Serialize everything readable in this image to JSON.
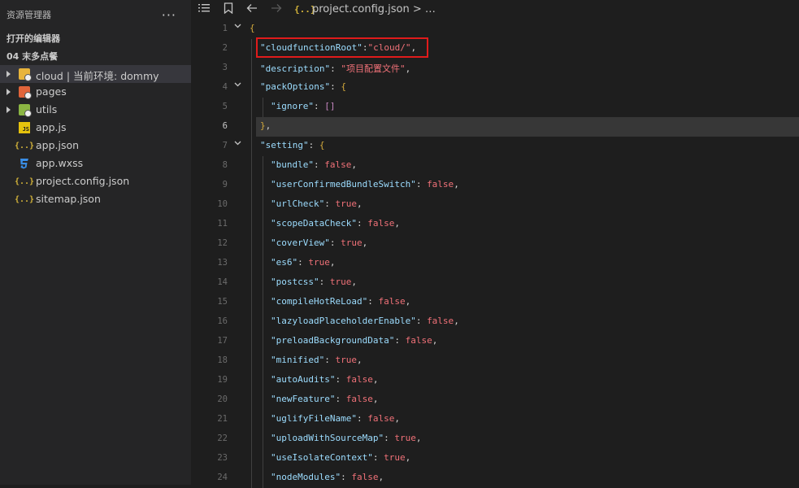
{
  "sidebar": {
    "title": "资源管理器",
    "more": "···",
    "open_editors": "打开的编辑器",
    "project": "04 末多点餐",
    "tree": [
      {
        "label": "cloud | 当前环境: dommy",
        "icon": "cloud-folder-icon",
        "folder": true
      },
      {
        "label": "pages",
        "icon": "pages-folder-icon",
        "folder": true
      },
      {
        "label": "utils",
        "icon": "utils-folder-icon",
        "folder": true
      },
      {
        "label": "app.js",
        "icon": "js-file-icon",
        "folder": false
      },
      {
        "label": "app.json",
        "icon": "json-file-icon",
        "folder": false
      },
      {
        "label": "app.wxss",
        "icon": "css-file-icon",
        "folder": false
      },
      {
        "label": "project.config.json",
        "icon": "json-file-icon",
        "folder": false
      },
      {
        "label": "sitemap.json",
        "icon": "json-file-icon",
        "folder": false
      }
    ]
  },
  "toolbar": {
    "json_icon": "{..}",
    "breadcrumb": "project.config.json > …"
  },
  "editor": {
    "active_line": 6,
    "lines": [
      {
        "n": "1",
        "text": "{"
      },
      {
        "n": "2",
        "text": "\"cloudfunctionRoot\":\"cloud/\","
      },
      {
        "n": "3",
        "text": "\"description\": \"项目配置文件\","
      },
      {
        "n": "4",
        "text": "\"packOptions\": {"
      },
      {
        "n": "5",
        "text": "\"ignore\": []"
      },
      {
        "n": "6",
        "text": "},"
      },
      {
        "n": "7",
        "text": "\"setting\": {"
      },
      {
        "n": "8",
        "text": "\"bundle\": false,"
      },
      {
        "n": "9",
        "text": "\"userConfirmedBundleSwitch\": false,"
      },
      {
        "n": "10",
        "text": "\"urlCheck\": true,"
      },
      {
        "n": "11",
        "text": "\"scopeDataCheck\": false,"
      },
      {
        "n": "12",
        "text": "\"coverView\": true,"
      },
      {
        "n": "13",
        "text": "\"es6\": true,"
      },
      {
        "n": "14",
        "text": "\"postcss\": true,"
      },
      {
        "n": "15",
        "text": "\"compileHotReLoad\": false,"
      },
      {
        "n": "16",
        "text": "\"lazyloadPlaceholderEnable\": false,"
      },
      {
        "n": "17",
        "text": "\"preloadBackgroundData\": false,"
      },
      {
        "n": "18",
        "text": "\"minified\": true,"
      },
      {
        "n": "19",
        "text": "\"autoAudits\": false,"
      },
      {
        "n": "20",
        "text": "\"newFeature\": false,"
      },
      {
        "n": "21",
        "text": "\"uglifyFileName\": false,"
      },
      {
        "n": "22",
        "text": "\"uploadWithSourceMap\": true,"
      },
      {
        "n": "23",
        "text": "\"useIsolateContext\": true,"
      },
      {
        "n": "24",
        "text": "\"nodeModules\": false,"
      }
    ]
  },
  "colors": {
    "highlight_box": "#e01b1b",
    "key": "#9cdcfe",
    "value": "#f07178"
  }
}
